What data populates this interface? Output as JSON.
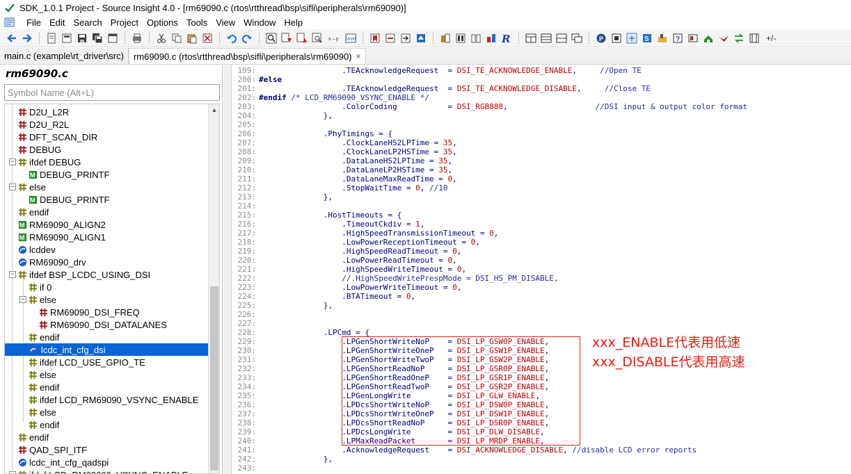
{
  "window": {
    "title": "SDK_1.0.1 Project - Source Insight 4.0 - [rm69090.c (rtos\\rtthread\\bsp\\sifli\\peripherals\\rm69090)]"
  },
  "menu": [
    "File",
    "Edit",
    "Search",
    "Project",
    "Options",
    "Tools",
    "View",
    "Window",
    "Help"
  ],
  "toolbar": {
    "overflow_label": "+/-"
  },
  "tabs": [
    {
      "label": "main.c (example\\rt_driver\\src)",
      "active": false
    },
    {
      "label": "rm69090.c (rtos\\rtthread\\bsp\\sifli\\peripherals\\rm69090)",
      "active": true,
      "close": "×"
    }
  ],
  "sidebar": {
    "title": "rm69090.c",
    "search_placeholder": "Symbol Name (Alt+L)",
    "symbols": [
      {
        "label": "D2U_L2R",
        "icon": "macro-icon",
        "level": 0,
        "expander": ""
      },
      {
        "label": "D2U_R2L",
        "icon": "macro-icon",
        "level": 0,
        "expander": ""
      },
      {
        "label": "DFT_SCAN_DIR",
        "icon": "macro-icon",
        "level": 0,
        "expander": ""
      },
      {
        "label": "DEBUG",
        "icon": "macro-icon",
        "level": 0,
        "expander": ""
      },
      {
        "label": "ifdef DEBUG",
        "icon": "condition-icon",
        "level": 0,
        "expander": "−"
      },
      {
        "label": "DEBUG_PRINTF",
        "icon": "function-macro-icon",
        "level": 1,
        "expander": ""
      },
      {
        "label": "else",
        "icon": "condition-icon",
        "level": 0,
        "expander": "−"
      },
      {
        "label": "DEBUG_PRINTF",
        "icon": "function-macro-icon",
        "level": 1,
        "expander": ""
      },
      {
        "label": "endif",
        "icon": "condition-icon",
        "level": 0,
        "expander": ""
      },
      {
        "label": "RM69090_ALIGN2",
        "icon": "function-macro-icon",
        "level": 0,
        "expander": ""
      },
      {
        "label": "RM69090_ALIGN1",
        "icon": "function-macro-icon",
        "level": 0,
        "expander": ""
      },
      {
        "label": "lcddev",
        "icon": "variable-icon",
        "level": 0,
        "expander": ""
      },
      {
        "label": "RM69090_drv",
        "icon": "variable-icon",
        "level": 0,
        "expander": ""
      },
      {
        "label": "ifdef BSP_LCDC_USING_DSI",
        "icon": "condition-icon",
        "level": 0,
        "expander": "−"
      },
      {
        "label": "if 0",
        "icon": "condition-icon",
        "level": 1,
        "expander": ""
      },
      {
        "label": "else",
        "icon": "condition-icon",
        "level": 1,
        "expander": "−"
      },
      {
        "label": "RM69090_DSI_FREQ",
        "icon": "macro-icon",
        "level": 2,
        "expander": ""
      },
      {
        "label": "RM69090_DSI_DATALANES",
        "icon": "macro-icon",
        "level": 2,
        "expander": ""
      },
      {
        "label": "endif",
        "icon": "condition-icon",
        "level": 1,
        "expander": ""
      },
      {
        "label": "lcdc_int_cfg_dsi",
        "icon": "variable-icon",
        "level": 1,
        "expander": "",
        "selected": true
      },
      {
        "label": "ifdef LCD_USE_GPIO_TE",
        "icon": "condition-icon",
        "level": 1,
        "expander": ""
      },
      {
        "label": "else",
        "icon": "condition-icon",
        "level": 1,
        "expander": ""
      },
      {
        "label": "endif",
        "icon": "condition-icon",
        "level": 1,
        "expander": ""
      },
      {
        "label": "ifdef LCD_RM69090_VSYNC_ENABLE",
        "icon": "condition-icon",
        "level": 1,
        "expander": ""
      },
      {
        "label": "else",
        "icon": "condition-icon",
        "level": 1,
        "expander": ""
      },
      {
        "label": "endif",
        "icon": "condition-icon",
        "level": 1,
        "expander": ""
      },
      {
        "label": "endif",
        "icon": "condition-icon",
        "level": 0,
        "expander": ""
      },
      {
        "label": "QAD_SPI_ITF",
        "icon": "macro-icon",
        "level": 0,
        "expander": ""
      },
      {
        "label": "lcdc_int_cfg_qadspi",
        "icon": "variable-icon",
        "level": 0,
        "expander": ""
      },
      {
        "label": "ifdef LCD_RM69090_VSYNC_ENABLE",
        "icon": "condition-icon",
        "level": 0,
        "expander": "−"
      }
    ]
  },
  "editor": {
    "lines": [
      {
        "n": "199:",
        "t": "                  .TEAcknowledgeRequest  = DSI_TE_ACKNOWLEDGE_ENABLE,     //Open TE"
      },
      {
        "n": "200:",
        "t": "#else"
      },
      {
        "n": "201:",
        "t": "                  .TEAcknowledgeRequest  = DSI_TE_ACKNOWLEDGE_DISABLE,     //Close TE"
      },
      {
        "n": "202:",
        "t": "#endif /* LCD_RM69090_VSYNC_ENABLE */"
      },
      {
        "n": "203:",
        "t": "                  .ColorCoding           = DSI_RGB888,                   //DSI input & output color format"
      },
      {
        "n": "204:",
        "t": "              },"
      },
      {
        "n": "205:",
        "t": ""
      },
      {
        "n": "206:",
        "t": "              .PhyTimings = {"
      },
      {
        "n": "207:",
        "t": "                  .ClockLaneHS2LPTime = 35,"
      },
      {
        "n": "208:",
        "t": "                  .ClockLaneLP2HSTime = 35,"
      },
      {
        "n": "209:",
        "t": "                  .DataLaneHS2LPTime = 35,"
      },
      {
        "n": "210:",
        "t": "                  .DataLaneLP2HSTime = 35,"
      },
      {
        "n": "211:",
        "t": "                  .DataLaneMaxReadTime = 0,"
      },
      {
        "n": "212:",
        "t": "                  .StopWaitTime = 0, //10"
      },
      {
        "n": "213:",
        "t": "              },"
      },
      {
        "n": "214:",
        "t": ""
      },
      {
        "n": "215:",
        "t": "              .HostTimeouts = {"
      },
      {
        "n": "216:",
        "t": "                  .TimeoutCkdiv = 1,"
      },
      {
        "n": "217:",
        "t": "                  .HighSpeedTransmissionTimeout = 0,"
      },
      {
        "n": "218:",
        "t": "                  .LowPowerReceptionTimeout = 0,"
      },
      {
        "n": "219:",
        "t": "                  .HighSpeedReadTimeout = 0,"
      },
      {
        "n": "220:",
        "t": "                  .LowPowerReadTimeout = 0,"
      },
      {
        "n": "221:",
        "t": "                  .HighSpeedWriteTimeout = 0,"
      },
      {
        "n": "222:",
        "t": "                  //.HighSpeedWritePrespMode = DSI_HS_PM_DISABLE,"
      },
      {
        "n": "223:",
        "t": "                  .LowPowerWriteTimeout = 0,"
      },
      {
        "n": "224:",
        "t": "                  .BTATimeout = 0,"
      },
      {
        "n": "225:",
        "t": "              },"
      },
      {
        "n": "226:",
        "t": ""
      },
      {
        "n": "227:",
        "t": ""
      },
      {
        "n": "228:",
        "t": "              .LPCmd = {"
      },
      {
        "n": "229:",
        "t": "                  .LPGenShortWriteNoP    = DSI_LP_GSW0P_ENABLE,"
      },
      {
        "n": "230:",
        "t": "                  .LPGenShortWriteOneP   = DSI_LP_GSW1P_ENABLE,"
      },
      {
        "n": "231:",
        "t": "                  .LPGenShortWriteTwoP   = DSI_LP_GSW2P_ENABLE,"
      },
      {
        "n": "232:",
        "t": "                  .LPGenShortReadNoP     = DSI_LP_GSR0P_ENABLE,"
      },
      {
        "n": "233:",
        "t": "                  .LPGenShortReadOneP    = DSI_LP_GSR1P_ENABLE,"
      },
      {
        "n": "234:",
        "t": "                  .LPGenShortReadTwoP    = DSI_LP_GSR2P_ENABLE,"
      },
      {
        "n": "235:",
        "t": "                  .LPGenLongWrite        = DSI_LP_GLW_ENABLE,"
      },
      {
        "n": "236:",
        "t": "                  .LPDcsShortWriteNoP    = DSI_LP_DSW0P_ENABLE,"
      },
      {
        "n": "237:",
        "t": "                  .LPDcsShortWriteOneP   = DSI_LP_DSW1P_ENABLE,"
      },
      {
        "n": "238:",
        "t": "                  .LPDcsShortReadNoP     = DSI_LP_DSR0P_ENABLE,"
      },
      {
        "n": "239:",
        "t": "                  .LPDcsLongWrite        = DSI_LP_DLW_DISABLE,"
      },
      {
        "n": "240:",
        "t": "                  .LPMaxReadPacket       = DSI_LP_MRDP_ENABLE,"
      },
      {
        "n": "241:",
        "t": "                  .AcknowledgeRequest    = DSI_ACKNOWLEDGE_DISABLE, //disable LCD error reports"
      },
      {
        "n": "242:",
        "t": "              },"
      },
      {
        "n": "243:",
        "t": ""
      }
    ]
  },
  "annotation": {
    "line1": "xxx_ENABLE代表用低速",
    "line2": "xxx_DISABLE代表用高速",
    "color": "#ef1a10"
  }
}
